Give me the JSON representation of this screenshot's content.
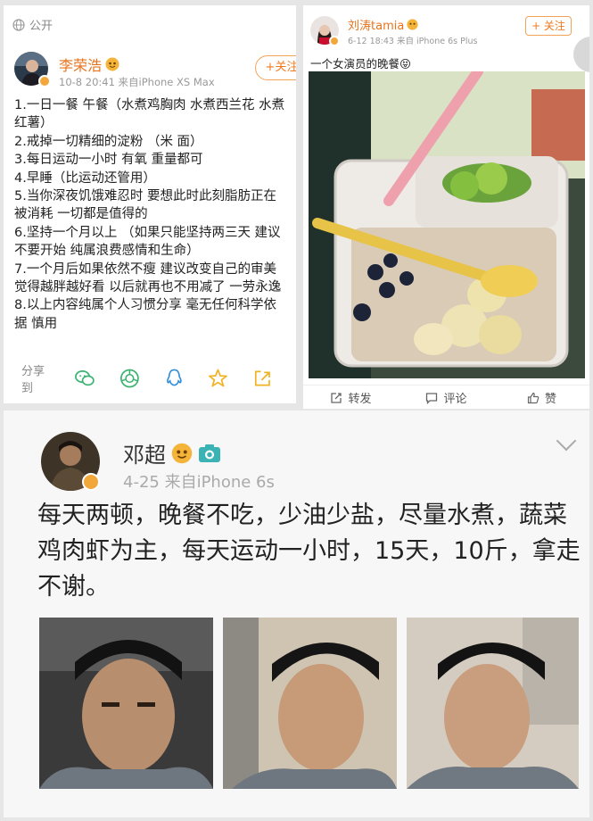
{
  "post1": {
    "visibility": "公开",
    "username": "李荣浩",
    "meta": "10-8 20:41  来自iPhone XS Max",
    "follow_label": "+关注",
    "lines": [
      "1.一日一餐 午餐（水煮鸡胸肉 水煮西兰花 水煮",
      "红薯）",
      "2.戒掉一切精细的淀粉 （米 面）",
      "3.每日运动一小时 有氧 重量都可",
      "4.早睡（比运动还管用）",
      "5.当你深夜饥饿难忍时 要想此时此刻脂肪正在",
      "被消耗 一切都是值得的",
      "6.坚持一个月以上 （如果只能坚持两三天 建议",
      "不要开始 纯属浪费感情和生命）",
      "7.一个月后如果依然不瘦 建议改变自己的审美",
      "觉得越胖越好看 以后就再也不用减了 一劳永逸",
      "8.以上内容纯属个人习惯分享 毫无任何科学依",
      "据 慎用"
    ],
    "share_label": "分享到",
    "share_icons": [
      "wechat-icon",
      "moments-icon",
      "qq-icon",
      "qzone-star-icon",
      "share-out-icon"
    ]
  },
  "post2": {
    "username": "刘涛tamia",
    "meta": "6-12 18:43  来自 iPhone 6s Plus",
    "follow_label": "+ 关注",
    "text": "一个女演员的晚餐😝",
    "actions": {
      "repost": "转发",
      "comment": "评论",
      "like": "赞"
    }
  },
  "post3": {
    "username": "邓超",
    "meta": "4-25  来自iPhone 6s",
    "text": "每天两顿，晚餐不吃，少油少盐，尽量水煮，蔬菜鸡肉虾为主，每天运动一小时，15天，10斤，拿走不谢。"
  },
  "colors": {
    "accent_orange": "#e8731d",
    "verified_gold": "#f2a73a",
    "share_green": "#3cb371",
    "share_blue": "#2e8ddb",
    "share_yellow": "#f0b323"
  }
}
